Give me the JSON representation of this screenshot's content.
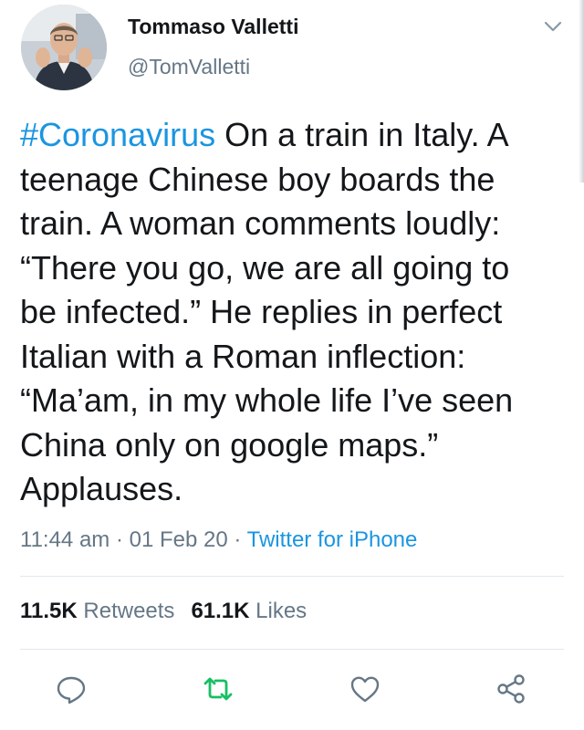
{
  "tweet": {
    "author": {
      "display_name": "Tommaso Valletti",
      "handle": "@TomValletti"
    },
    "text_lines": [
      {
        "hashtag": "#Coronavirus",
        "text": " On a train in Italy. A"
      },
      {
        "text": "teenage Chinese boy boards the"
      },
      {
        "text": "train. A woman comments loudly:"
      },
      {
        "text": "“There you go, we are all going to"
      },
      {
        "text": "be infected.” He replies in perfect"
      },
      {
        "text": "Italian with a Roman inflection:"
      },
      {
        "text": "“Ma’am, in my whole life I’ve seen"
      },
      {
        "text": "China only on google maps.”"
      },
      {
        "text": "Applauses."
      }
    ],
    "time": "11:44 am",
    "date": "01 Feb 20",
    "separator": " · ",
    "source": "Twitter for iPhone",
    "stats": {
      "retweets_count": "11.5K",
      "retweets_label": " Retweets",
      "likes_count": "61.1K",
      "likes_label": " Likes"
    }
  },
  "icons": {
    "more": "chevron-down-icon",
    "reply": "reply-icon",
    "retweet": "retweet-icon",
    "like": "heart-icon",
    "share": "share-icon"
  },
  "colors": {
    "link": "#1b95e0",
    "secondary_text": "#657786",
    "primary_text": "#14171a",
    "retweet_active": "#17bf63",
    "divider": "#e1e8ed"
  }
}
